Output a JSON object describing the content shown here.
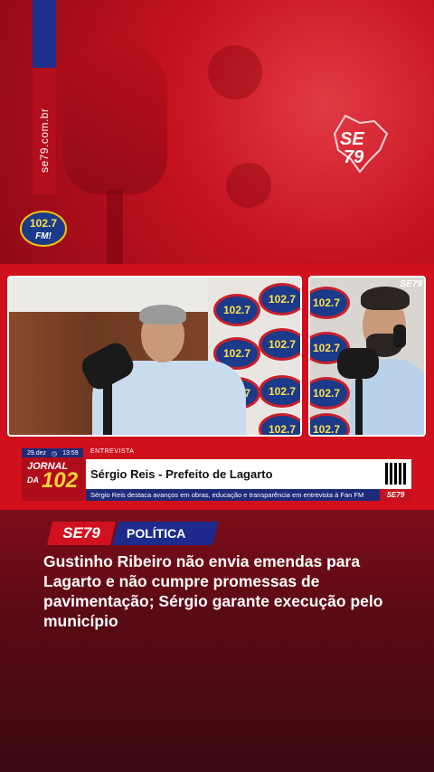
{
  "banner": {
    "site_url": "se79.com.br",
    "se79_logo": "SE79",
    "fm_logo": "102.7 FM!"
  },
  "video": {
    "backdrop_logo": "102.7 FM!",
    "corner_logo": "SE79"
  },
  "lower_third": {
    "date": "29.dez",
    "time": "13:59",
    "tag": "ENTREVISTA",
    "show_logo_line1": "JORNAL",
    "show_logo_line2": "DA",
    "show_logo_number": "102",
    "name_title": "Sérgio Reis - Prefeito de Lagarto",
    "subtitle": "Sérgio Reis destaca avanços em obras, educação e transparência em entrevista à Fan FM",
    "brand": "SE79"
  },
  "article": {
    "brand_badge": "SE79",
    "category": "POLÍTICA",
    "headline": "Gustinho Ribeiro não envia emendas para Lagarto e não cumpre promessas de pavimentação; Sérgio garante execução pelo município"
  },
  "colors": {
    "brand_red": "#d11120",
    "brand_blue": "#1e2a8c",
    "bg_dark": "#3d0a12"
  }
}
